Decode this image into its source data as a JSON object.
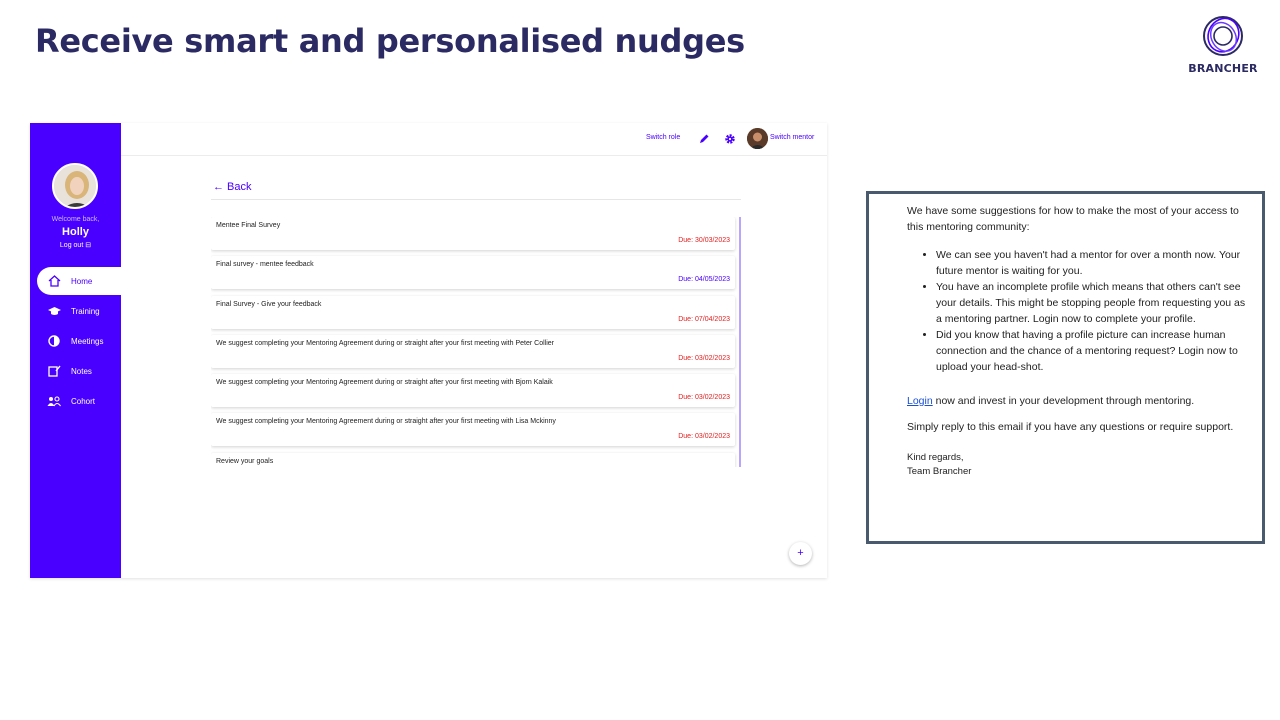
{
  "slide": {
    "title": "Receive smart and personalised nudges",
    "logo_text": "BRANCHER",
    "brand_color": "#4a00ff",
    "title_color": "#2b2a63"
  },
  "sidebar": {
    "welcome": "Welcome back,",
    "user_name": "Holly",
    "logout": "Log out",
    "items": [
      {
        "label": "Home",
        "icon": "home-icon",
        "active": true
      },
      {
        "label": "Training",
        "icon": "graduation-cap-icon",
        "active": false
      },
      {
        "label": "Meetings",
        "icon": "meetings-icon",
        "active": false
      },
      {
        "label": "Notes",
        "icon": "notes-icon",
        "active": false
      },
      {
        "label": "Cohort",
        "icon": "cohort-icon",
        "active": false
      }
    ]
  },
  "topbar": {
    "switch_role": "Switch role",
    "switch_mentor": "Switch mentor"
  },
  "main": {
    "back_label": "← Back",
    "tasks": [
      {
        "title": "Mentee Final Survey",
        "due": "Due: 30/03/2023",
        "due_color": "#e02020"
      },
      {
        "title": "Final survey - mentee feedback",
        "due": "Due: 04/05/2023",
        "due_color": "#4a00ff"
      },
      {
        "title": "Final Survey - Give your feedback",
        "due": "Due: 07/04/2023",
        "due_color": "#e02020"
      },
      {
        "title": "We suggest completing your Mentoring Agreement during or straight after your first meeting with Peter Collier",
        "due": "Due: 03/02/2023",
        "due_color": "#e02020"
      },
      {
        "title": "We suggest completing your Mentoring Agreement during or straight after your first meeting with Bjorn Kalaik",
        "due": "Due: 03/02/2023",
        "due_color": "#e02020"
      },
      {
        "title": "We suggest completing your Mentoring Agreement during or straight after your first meeting with Lisa Mckinny",
        "due": "Due: 03/02/2023",
        "due_color": "#e02020"
      },
      {
        "title": "Review your goals",
        "due": "",
        "due_color": "#e02020"
      }
    ],
    "fab_label": "+"
  },
  "email": {
    "intro": "We have some suggestions for how to make the most of your access to this mentoring community:",
    "bullets": [
      "We can see you haven't had a mentor for over a month now. Your future mentor is waiting for you.",
      "You have an incomplete profile which means that others can't see your details. This might be stopping people from requesting you as a mentoring partner. Login now to complete your profile.",
      "Did you know that having a profile picture can increase human connection and the chance of a mentoring request? Login now to upload your head-shot."
    ],
    "login_link": "Login",
    "login_rest": " now and invest in your development through mentoring.",
    "reply_text": "Simply reply to this email if you have any questions or require support.",
    "regards": "Kind regards,",
    "team": "Team Brancher"
  }
}
